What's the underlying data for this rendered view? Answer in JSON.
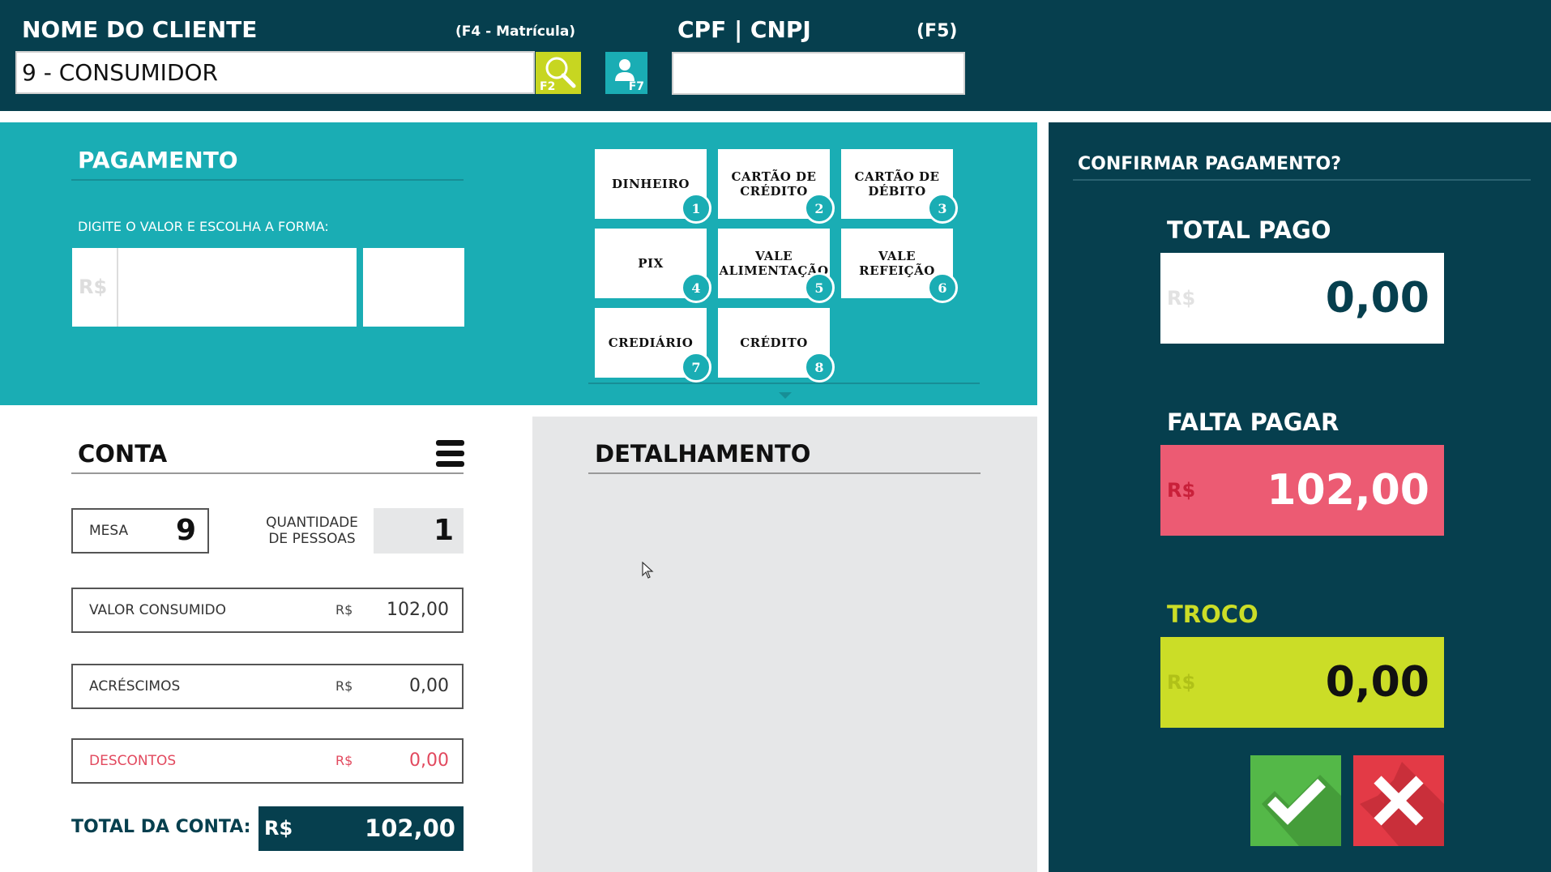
{
  "header": {
    "client_label": "NOME DO CLIENTE",
    "client_hint": "(F4 - Matrícula)",
    "client_value": "9 - CONSUMIDOR",
    "search_key": "F2",
    "user_key": "F7",
    "cpf_label": "CPF | CNPJ",
    "cpf_hint": "(F5)",
    "cpf_value": ""
  },
  "payment": {
    "title": "PAGAMENTO",
    "instruction": "DIGITE O VALOR E ESCOLHA A FORMA:",
    "currency": "R$",
    "methods": [
      {
        "label": "DINHEIRO",
        "num": "1"
      },
      {
        "label": "CARTÃO DE CRÉDITO",
        "num": "2"
      },
      {
        "label": "CARTÃO DE DÉBITO",
        "num": "3"
      },
      {
        "label": "PIX",
        "num": "4"
      },
      {
        "label": "VALE ALIMENTAÇÃO",
        "num": "5"
      },
      {
        "label": "VALE REFEIÇÃO",
        "num": "6"
      },
      {
        "label": "CREDIÁRIO",
        "num": "7"
      },
      {
        "label": "CRÉDITO",
        "num": "8"
      }
    ]
  },
  "conta": {
    "title": "CONTA",
    "mesa_label": "MESA",
    "mesa_value": "9",
    "qtd_label": "QUANTIDADE DE PESSOAS",
    "qtd_value": "1",
    "currency": "R$",
    "consumido_label": "VALOR CONSUMIDO",
    "consumido_value": "102,00",
    "acrescimos_label": "ACRÉSCIMOS",
    "acrescimos_value": "0,00",
    "descontos_label": "DESCONTOS",
    "descontos_value": "0,00",
    "total_label": "TOTAL DA CONTA:",
    "total_value": "102,00"
  },
  "detalhamento": {
    "title": "DETALHAMENTO"
  },
  "confirm": {
    "title": "CONFIRMAR PAGAMENTO?",
    "currency": "R$",
    "total_pago_label": "TOTAL PAGO",
    "total_pago_value": "0,00",
    "falta_label": "FALTA PAGAR",
    "falta_value": "102,00",
    "troco_label": "TROCO",
    "troco_value": "0,00"
  },
  "colors": {
    "header_bg": "#063f4e",
    "teal": "#1aadb4",
    "falta_bg": "#ec5b73",
    "troco_bg": "#cbdd27",
    "confirm_bg": "#54b848",
    "cancel_bg": "#e33a46"
  }
}
